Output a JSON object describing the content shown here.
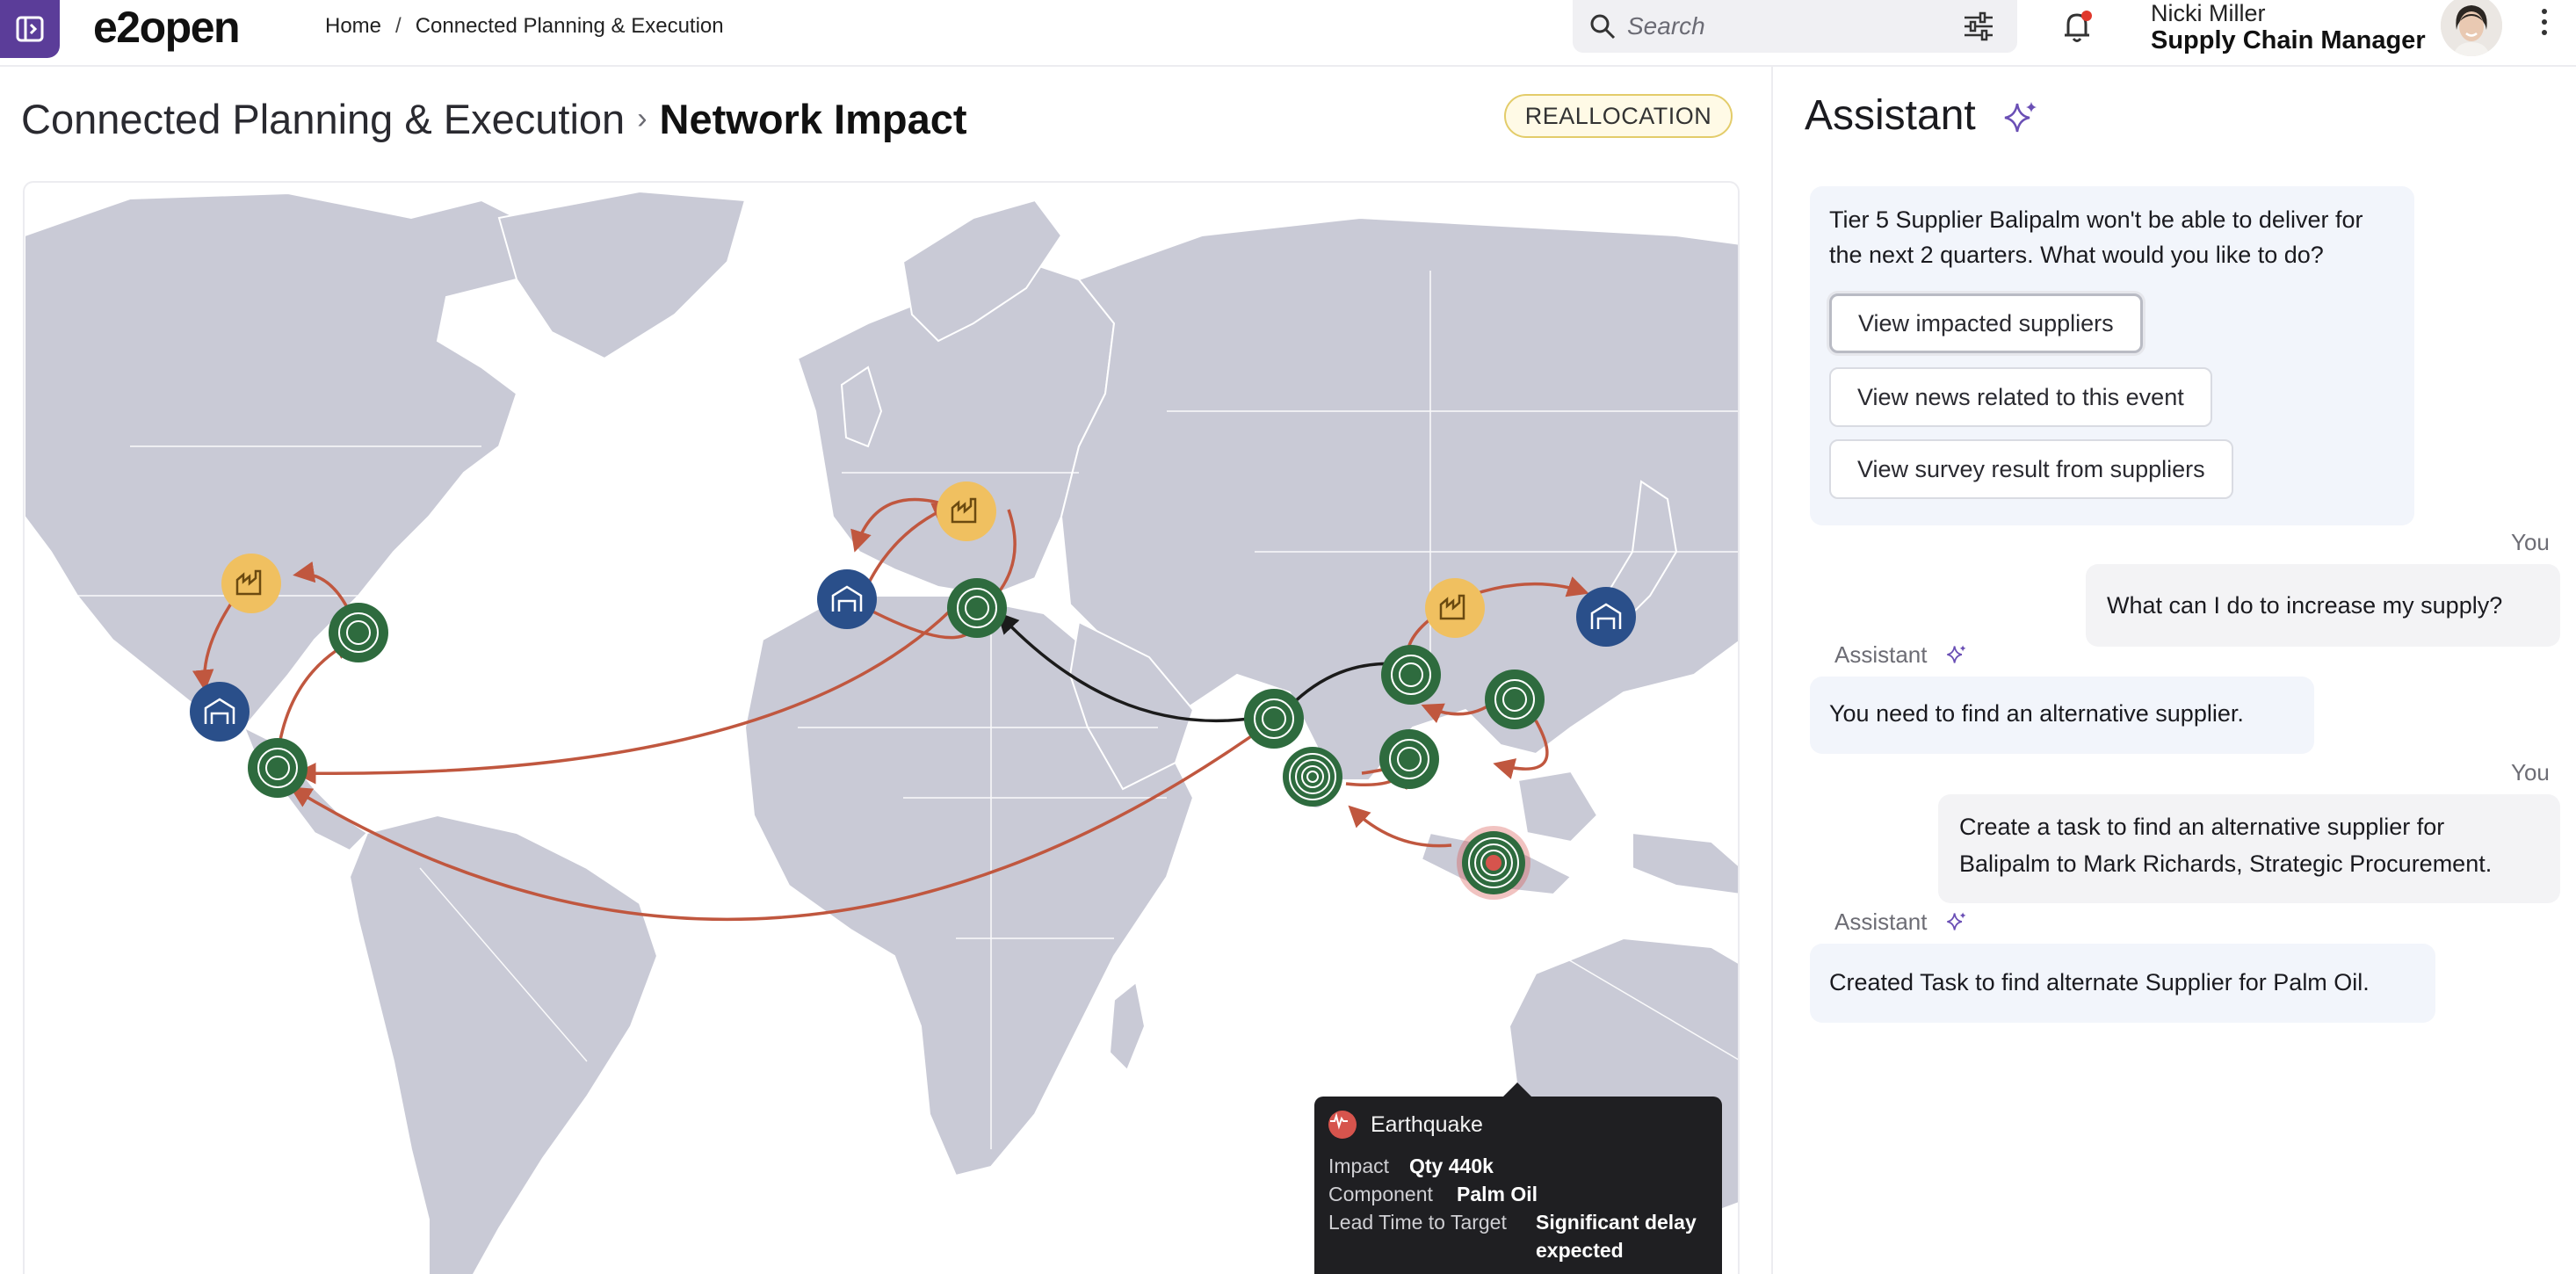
{
  "app": {
    "logo": "e2open"
  },
  "breadcrumb": {
    "home": "Home",
    "separator": "/",
    "current": "Connected Planning & Execution"
  },
  "search": {
    "placeholder": "Search"
  },
  "user": {
    "name": "Nicki Miller",
    "role": "Supply Chain Manager"
  },
  "page": {
    "title_parent": "Connected Planning & Execution",
    "title_current": "Network Impact",
    "badge": "REALLOCATION"
  },
  "tooltip": {
    "title": "Earthquake",
    "impact_label": "Impact",
    "impact_value": "Qty 440k",
    "component_label": "Component",
    "component_value": "Palm Oil",
    "lead_label": "Lead Time to Target",
    "lead_value_line1": "Significant delay",
    "lead_value_line2": "expected"
  },
  "assistant": {
    "title": "Assistant",
    "messages": [
      {
        "speaker": "Assistant",
        "line1": "Tier 5 Supplier Balipalm won't be able to deliver for",
        "line2": "the next 2 quarters. What would you like to do?"
      },
      {
        "speaker": "You",
        "line1": "What can I do to increase my supply?"
      },
      {
        "speaker": "Assistant",
        "line1": "You need to find an alternative supplier."
      },
      {
        "speaker": "You",
        "line1": "Create a task to find an alternative supplier for",
        "line2": "Balipalm to Mark Richards, Strategic Procurement."
      },
      {
        "speaker": "Assistant",
        "line1": "Created Task to find  alternate Supplier for Palm Oil."
      }
    ],
    "options": [
      "View impacted suppliers",
      "View news related to this event",
      "View survey result from suppliers"
    ]
  },
  "colors": {
    "brand_purple": "#5b3d99",
    "supplier_green": "#2e6b3e",
    "factory_yellow": "#f0c060",
    "warehouse_blue": "#2a4f8a",
    "route_red": "#c0573f",
    "alert_red": "#d6544d",
    "land": "#c9cad6"
  },
  "map_nodes": [
    {
      "type": "factory",
      "region": "North America"
    },
    {
      "type": "supplier",
      "region": "US East"
    },
    {
      "type": "warehouse",
      "region": "Mexico"
    },
    {
      "type": "supplier",
      "region": "Central America"
    },
    {
      "type": "warehouse",
      "region": "Western Europe"
    },
    {
      "type": "factory",
      "region": "Central Europe"
    },
    {
      "type": "supplier",
      "region": "Eastern Europe"
    },
    {
      "type": "supplier",
      "region": "India"
    },
    {
      "type": "supplier",
      "region": "South India"
    },
    {
      "type": "supplier",
      "region": "China West"
    },
    {
      "type": "factory",
      "region": "China North"
    },
    {
      "type": "warehouse",
      "region": "Japan"
    },
    {
      "type": "supplier",
      "region": "China East"
    },
    {
      "type": "supplier",
      "region": "Southeast Asia"
    },
    {
      "type": "alert",
      "region": "Indonesia"
    }
  ]
}
